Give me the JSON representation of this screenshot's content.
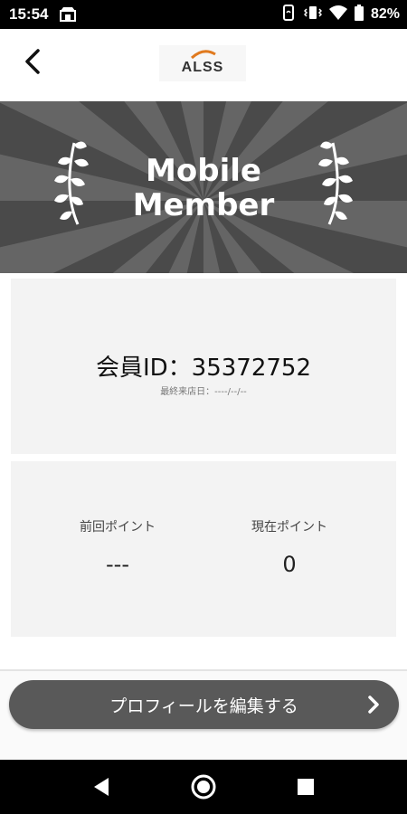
{
  "status_bar": {
    "time": "15:54",
    "battery": "82%",
    "icons": [
      "store-notification-icon",
      "nfc-payment-icon",
      "vibrate-icon",
      "wifi-icon",
      "battery-icon"
    ]
  },
  "app_bar": {
    "back_icon": "chevron-left-icon",
    "logo_text": "ALSS"
  },
  "banner": {
    "line1": "Mobile",
    "line2": "Member"
  },
  "member": {
    "id_text": "会員ID：35372752",
    "last_visit": "最終来店日：----/--/--"
  },
  "points": {
    "previous_label": "前回ポイント",
    "previous_value": "---",
    "current_label": "現在ポイント",
    "current_value": "0"
  },
  "actions": {
    "edit_profile_label": "プロフィールを編集する"
  },
  "colors": {
    "status_bar": "#000000",
    "banner_bg": "#4a4a4a",
    "banner_ray": "#6a6a6a",
    "card_bg": "#f3f3f3",
    "button_bg": "#595959"
  }
}
